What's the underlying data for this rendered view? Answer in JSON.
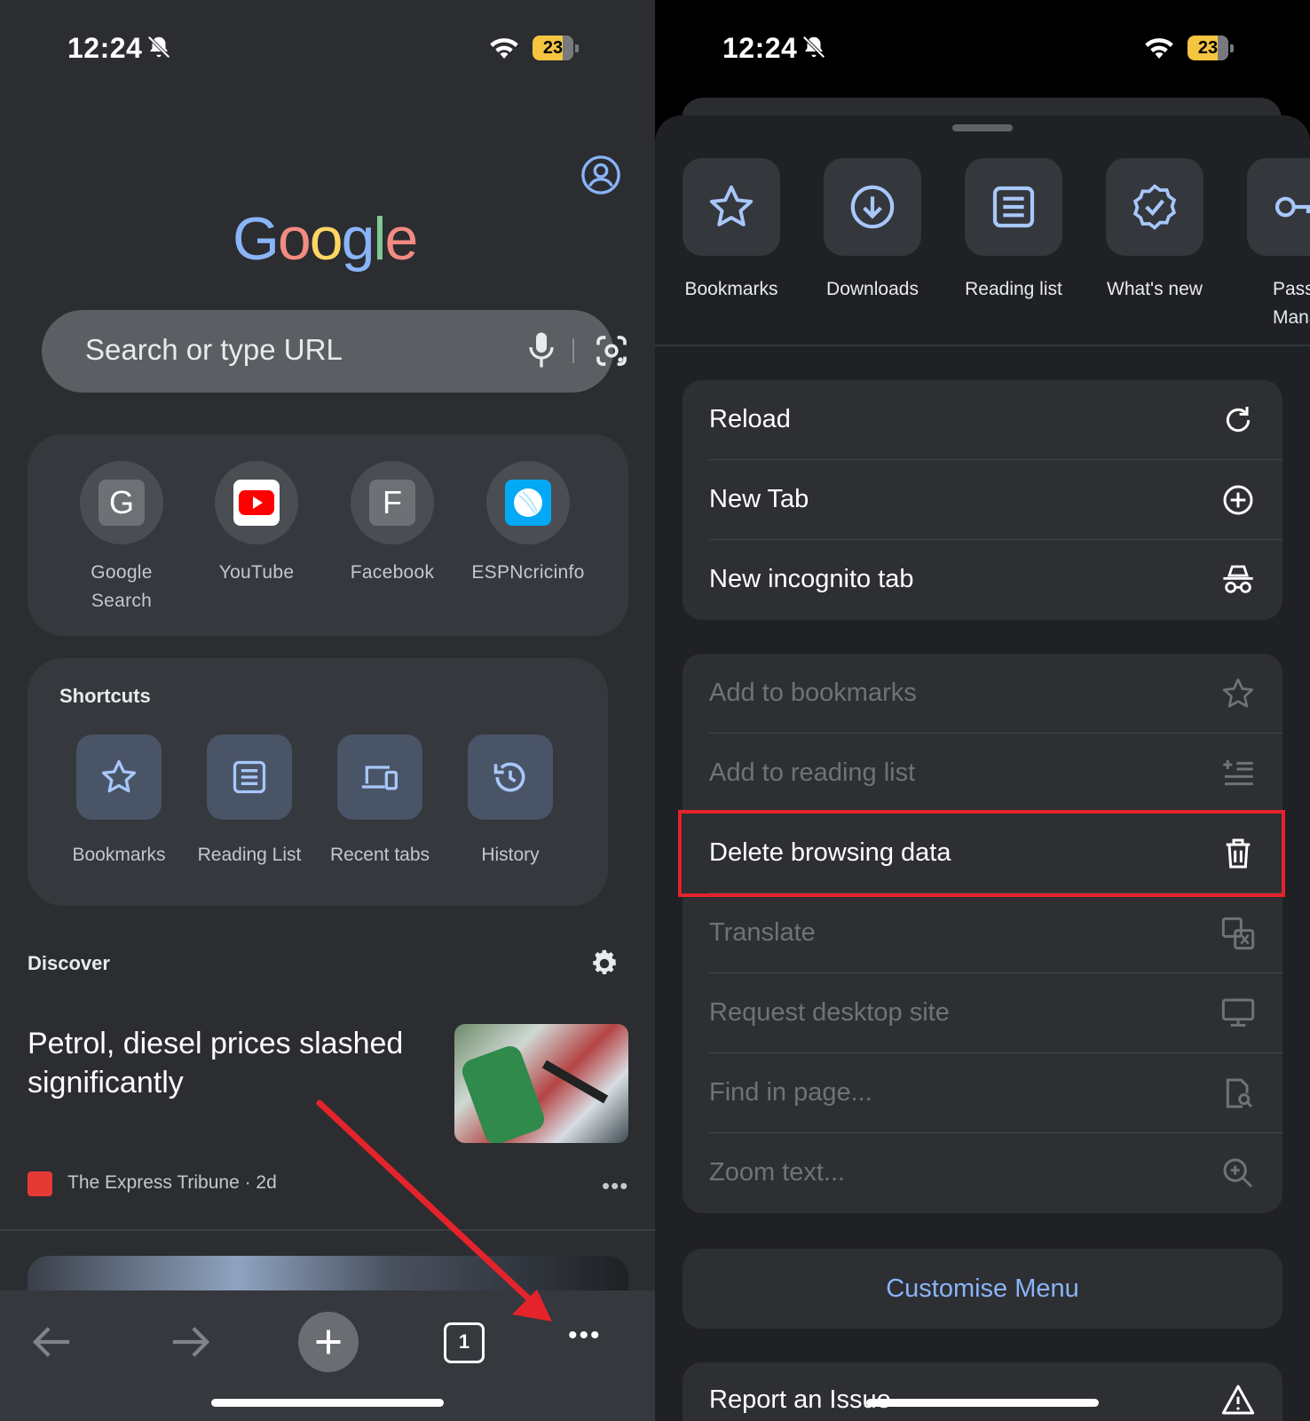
{
  "colors": {
    "left_bg": "#2b2d31",
    "card_bg": "#35383d",
    "menu_bg": "#202124",
    "accent_blue": "#8ab4f8",
    "highlight_red": "#e4232b",
    "battery_yellow": "#f5c542"
  },
  "left": {
    "status": {
      "time": "12:24",
      "battery": "23"
    },
    "google_logo": {
      "letters": [
        "G",
        "o",
        "o",
        "g",
        "l",
        "e"
      ],
      "colors": [
        "#8ab4f8",
        "#f28b82",
        "#fdd663",
        "#8ab4f8",
        "#81c995",
        "#f28b82"
      ]
    },
    "search": {
      "placeholder": "Search or type URL"
    },
    "most_visited": [
      {
        "label_line1": "Google",
        "label_line2": "Search",
        "icon": "G"
      },
      {
        "label_line1": "YouTube",
        "label_line2": "",
        "icon": "youtube-icon"
      },
      {
        "label_line1": "Facebook",
        "label_line2": "",
        "icon": "F"
      },
      {
        "label_line1": "ESPNcricinfo",
        "label_line2": "",
        "icon": "espncricinfo-icon"
      }
    ],
    "shortcuts": {
      "title": "Shortcuts",
      "items": [
        {
          "label": "Bookmarks",
          "icon": "star-icon"
        },
        {
          "label": "Reading List",
          "icon": "list-icon"
        },
        {
          "label": "Recent tabs",
          "icon": "devices-icon"
        },
        {
          "label": "History",
          "icon": "history-icon"
        }
      ]
    },
    "discover": {
      "title": "Discover",
      "article": {
        "headline": "Petrol, diesel prices slashed significantly",
        "source": "The Express Tribune · 2d"
      }
    },
    "toolbar": {
      "tab_count": "1"
    }
  },
  "right": {
    "status": {
      "time": "12:24",
      "battery": "23"
    },
    "quick_actions": [
      {
        "label": "Bookmarks",
        "icon": "star-icon"
      },
      {
        "label": "Downloads",
        "icon": "download-icon"
      },
      {
        "label": "Reading list",
        "icon": "list-icon"
      },
      {
        "label": "What's new",
        "icon": "badge-check-icon"
      },
      {
        "label": "Passw",
        "label2": "Manag",
        "icon": "key-icon"
      }
    ],
    "menu_group1": [
      {
        "label": "Reload",
        "icon": "reload-icon"
      },
      {
        "label": "New Tab",
        "icon": "plus-circle-icon"
      },
      {
        "label": "New incognito tab",
        "icon": "incognito-icon"
      }
    ],
    "menu_group2": [
      {
        "label": "Add to bookmarks",
        "icon": "star-icon",
        "enabled": false
      },
      {
        "label": "Add to reading list",
        "icon": "add-list-icon",
        "enabled": false
      },
      {
        "label": "Delete browsing data",
        "icon": "trash-icon",
        "enabled": true
      },
      {
        "label": "Translate",
        "icon": "translate-icon",
        "enabled": false
      },
      {
        "label": "Request desktop site",
        "icon": "desktop-icon",
        "enabled": false
      },
      {
        "label": "Find in page...",
        "icon": "find-icon",
        "enabled": false
      },
      {
        "label": "Zoom text...",
        "icon": "zoom-icon",
        "enabled": false
      }
    ],
    "customise": "Customise Menu",
    "report": "Report an Issue"
  }
}
